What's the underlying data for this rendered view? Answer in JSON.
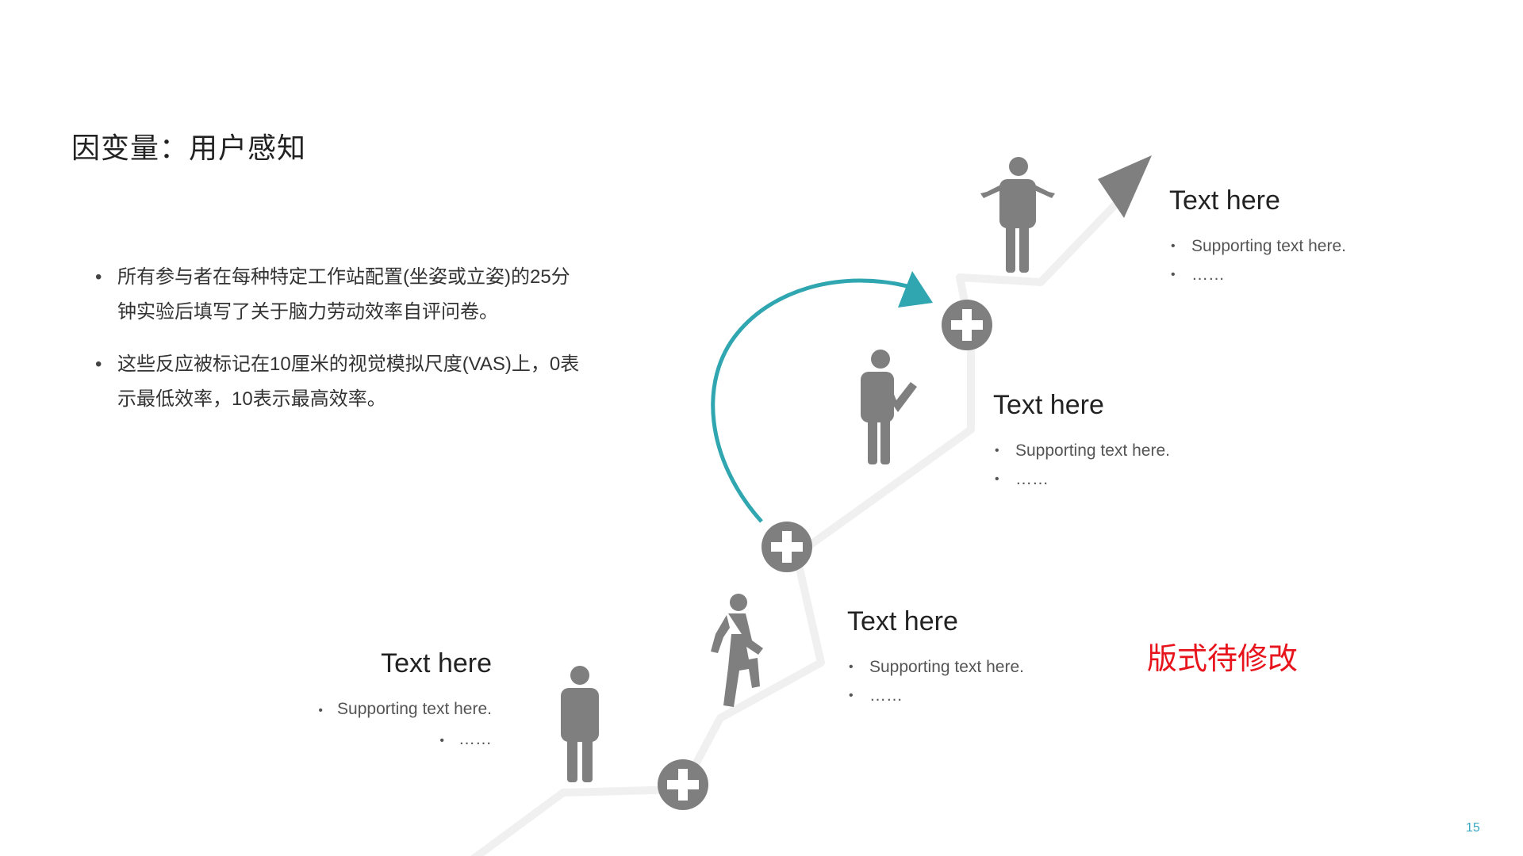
{
  "title": "因变量：用户感知",
  "intro": [
    "所有参与者在每种特定工作站配置(坐姿或立姿)的25分钟实验后填写了关于脑力劳动效率自评问卷。",
    "这些反应被标记在10厘米的视觉模拟尺度(VAS)上，0表示最低效率，10表示最高效率。"
  ],
  "steps": [
    {
      "heading": "Text here",
      "bullets": [
        "Supporting text here.",
        "……"
      ]
    },
    {
      "heading": "Text here",
      "bullets": [
        "Supporting text here.",
        "……"
      ]
    },
    {
      "heading": "Text here",
      "bullets": [
        "Supporting text here.",
        "……"
      ]
    },
    {
      "heading": "Text here",
      "bullets": [
        "Supporting text here.",
        "……"
      ]
    }
  ],
  "note": "版式待修改",
  "page_number": "15",
  "colors": {
    "path": "#f0f0f0",
    "figure": "#7f7f7f",
    "arc": "#2fa6b0",
    "note": "#e8141c",
    "page_number": "#3aa9c4"
  },
  "icons": [
    "plus-circle-icon",
    "person-standing-icon",
    "person-walking-icon",
    "person-pointing-icon",
    "person-shrugging-icon",
    "arrow-head-icon"
  ]
}
